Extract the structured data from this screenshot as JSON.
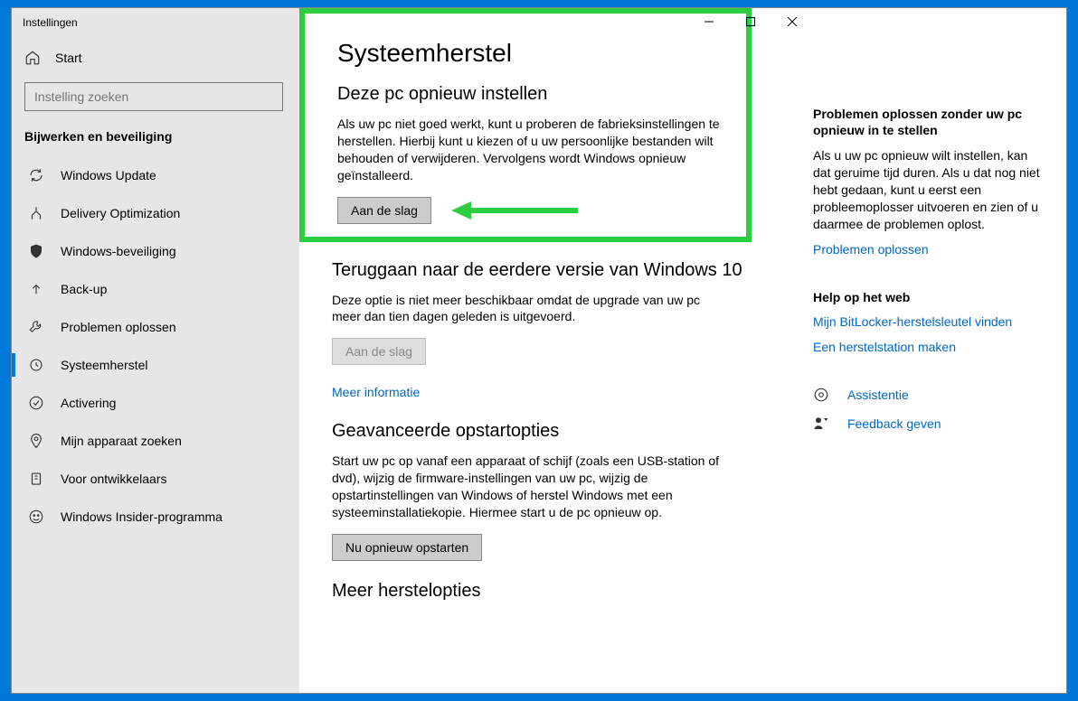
{
  "window": {
    "title": "Instellingen"
  },
  "win_controls": {
    "min": "—",
    "max": "▢",
    "close": "✕"
  },
  "sidebar": {
    "home_label": "Start",
    "search_placeholder": "Instelling zoeken",
    "section_label": "Bijwerken en beveiliging",
    "items": [
      {
        "label": "Windows Update",
        "icon": "sync"
      },
      {
        "label": "Delivery Optimization",
        "icon": "delivery"
      },
      {
        "label": "Windows-beveiliging",
        "icon": "shield"
      },
      {
        "label": "Back-up",
        "icon": "backup"
      },
      {
        "label": "Problemen oplossen",
        "icon": "troubleshoot"
      },
      {
        "label": "Systeemherstel",
        "icon": "recovery",
        "selected": true
      },
      {
        "label": "Activering",
        "icon": "activation"
      },
      {
        "label": "Mijn apparaat zoeken",
        "icon": "find"
      },
      {
        "label": "Voor ontwikkelaars",
        "icon": "dev"
      },
      {
        "label": "Windows Insider-programma",
        "icon": "insider"
      }
    ]
  },
  "main": {
    "title": "Systeemherstel",
    "reset": {
      "heading": "Deze pc opnieuw instellen",
      "body": "Als uw pc niet goed werkt, kunt u proberen de fabrieksinstellingen te herstellen. Hierbij kunt u kiezen of u uw persoonlijke bestanden wilt behouden of verwijderen. Vervolgens wordt Windows opnieuw geïnstalleerd.",
      "button": "Aan de slag"
    },
    "goback": {
      "heading": "Teruggaan naar de eerdere versie van Windows 10",
      "body": "Deze optie is niet meer beschikbaar omdat de upgrade van uw pc meer dan tien dagen geleden is uitgevoerd.",
      "button": "Aan de slag",
      "link": "Meer informatie"
    },
    "advanced": {
      "heading": "Geavanceerde opstartopties",
      "body": "Start uw pc op vanaf een apparaat of schijf (zoals een USB-station of dvd), wijzig de firmware-instellingen van uw pc, wijzig de opstartinstellingen van Windows of herstel Windows met een systeeminstallatiekopie. Hiermee start u de pc opnieuw op.",
      "button": "Nu opnieuw opstarten"
    },
    "more": {
      "heading": "Meer herstelopties"
    }
  },
  "right": {
    "troubleshoot": {
      "heading": "Problemen oplossen zonder uw pc opnieuw in te stellen",
      "body": "Als u uw pc opnieuw wilt instellen, kan dat geruime tijd duren. Als u dat nog niet hebt gedaan, kunt u eerst een probleemoplosser uitvoeren en zien of u daarmee de problemen oplost.",
      "link": "Problemen oplossen"
    },
    "web": {
      "heading": "Help op het web",
      "links": [
        "Mijn BitLocker-herstelsleutel vinden",
        "Een herstelstation maken"
      ]
    },
    "support": {
      "assist": "Assistentie",
      "feedback": "Feedback geven"
    }
  }
}
